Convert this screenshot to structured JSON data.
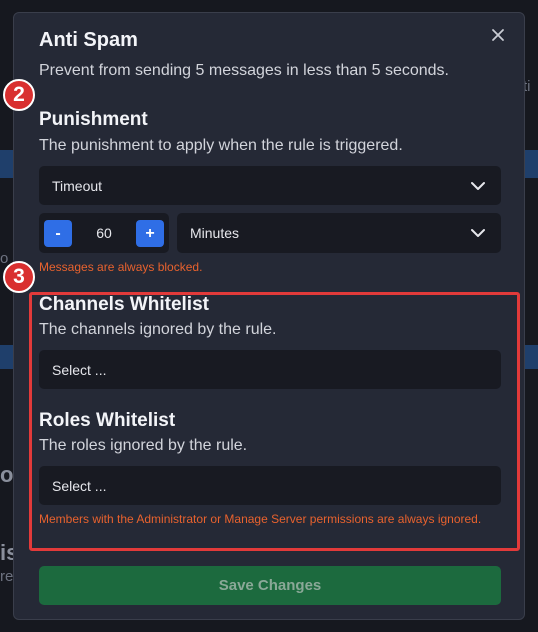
{
  "modal": {
    "title": "Anti Spam",
    "description": "Prevent from sending 5 messages in less than 5 seconds."
  },
  "punishment": {
    "title": "Punishment",
    "description": "The punishment to apply when the rule is triggered.",
    "type_value": "Timeout",
    "duration_value": "60",
    "decrement_label": "-",
    "increment_label": "+",
    "unit_value": "Minutes",
    "note": "Messages are always blocked."
  },
  "channels_whitelist": {
    "title": "Channels Whitelist",
    "description": "The channels ignored by the rule.",
    "placeholder": "Select ..."
  },
  "roles_whitelist": {
    "title": "Roles Whitelist",
    "description": "The roles ignored by the rule.",
    "placeholder": "Select ..."
  },
  "permissions_note": "Members with the Administrator or Manage Server permissions are always ignored.",
  "save_label": "Save Changes",
  "annotations": {
    "badge_2": "2",
    "badge_3": "3"
  },
  "background_fragments": {
    "frag_a": "ti",
    "frag_b": "o",
    "frag_c": "or",
    "frag_d": "is",
    "frag_e": "re"
  },
  "colors": {
    "accent": "#2f6ee6",
    "danger": "#e23a3a",
    "warning": "#e8622e",
    "save": "#1c6a3e"
  }
}
